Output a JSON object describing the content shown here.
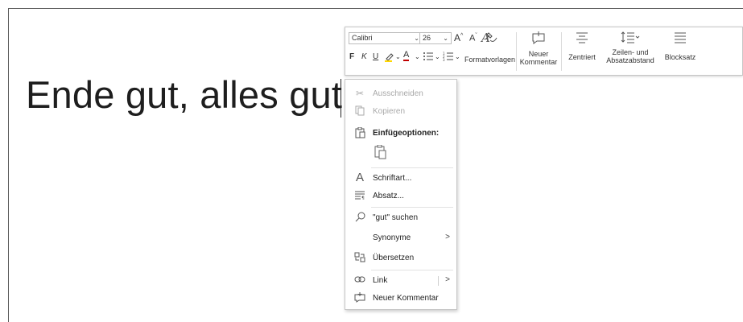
{
  "document": {
    "text": "Ende gut, alles gut"
  },
  "toolbar": {
    "font_name": "Calibri",
    "font_size": "26",
    "grow_font_icon": "A^",
    "shrink_font_icon": "Aˇ",
    "format_painter_icon": "format-painter-icon",
    "bold": "F",
    "italic": "K",
    "underline": "U",
    "highlight_icon": "highlight-icon",
    "font_color_icon": "A",
    "bullets_icon": "bullets-icon",
    "numbering_icon": "numbering-icon",
    "styles_label": "Formatvorlagen",
    "new_comment_label_1": "Neuer",
    "new_comment_label_2": "Kommentar",
    "center_label": "Zentriert",
    "spacing_label_1": "Zeilen- und",
    "spacing_label_2": "Absatzabstand",
    "justify_label": "Blocksatz"
  },
  "context_menu": {
    "cut": "Ausschneiden",
    "copy": "Kopieren",
    "paste_options": "Einfügeoptionen:",
    "font": "Schriftart...",
    "paragraph": "Absatz...",
    "search": "\"gut\" suchen",
    "synonyms": "Synonyme",
    "translate": "Übersetzen",
    "link": "Link",
    "new_comment": "Neuer Kommentar",
    "submenu_arrow": ">"
  }
}
